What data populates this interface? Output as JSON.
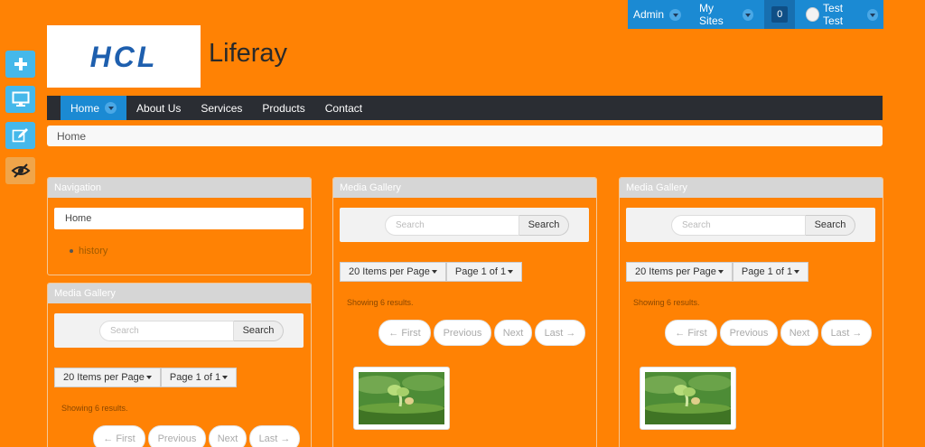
{
  "dockbar": {
    "admin_label": "Admin",
    "mysites_label": "My Sites",
    "notifications_count": "0",
    "user_name": "Test Test"
  },
  "header": {
    "logo_text": "HCL",
    "site_name": "Liferay"
  },
  "nav": {
    "items": [
      {
        "label": "Home"
      },
      {
        "label": "About Us"
      },
      {
        "label": "Services"
      },
      {
        "label": "Products"
      },
      {
        "label": "Contact"
      }
    ]
  },
  "breadcrumb": {
    "label": "Home"
  },
  "navigation_portlet": {
    "title": "Navigation",
    "home_label": "Home",
    "child_label": "history"
  },
  "media_gallery": {
    "title": "Media Gallery",
    "search_placeholder": "Search",
    "search_button": "Search",
    "items_per_page": "20 Items per Page",
    "page_of": "Page 1 of 1",
    "showing": "Showing 6 results.",
    "pager": {
      "first": "← First",
      "previous": "Previous",
      "next": "Next",
      "last": "Last →"
    }
  },
  "colors": {
    "background": "#ff8204",
    "dockbar": "#1b8ad3",
    "navbar": "#2a2d33",
    "logo_blue": "#1e5fae"
  }
}
